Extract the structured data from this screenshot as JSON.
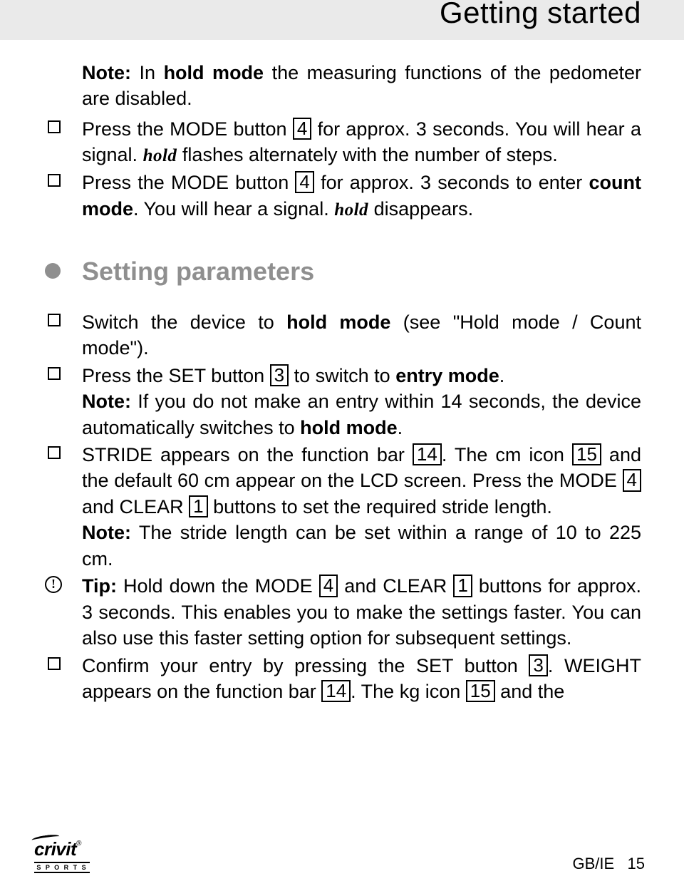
{
  "header": {
    "title": "Getting started"
  },
  "intro": {
    "note_label": "Note:",
    "note_a": " In ",
    "note_b": "hold mode",
    "note_c": " the measuring functions of the pedometer are disabled."
  },
  "top_items": [
    {
      "bullet": "square",
      "t1": "Press the MODE button ",
      "n1": "4",
      "t2": " for approx. 3 seconds. You will hear a signal. ",
      "hold": "hold",
      "t3": " flashes alternately with the number of steps."
    },
    {
      "bullet": "square",
      "t1": "Press the MODE button ",
      "n1": "4",
      "t2": " for approx. 3 seconds to enter ",
      "b1": "count mode",
      "t3": ". You will hear a signal. ",
      "hold": "hold",
      "t4": " disappears."
    }
  ],
  "section": {
    "heading": "Setting parameters"
  },
  "items": [
    {
      "bullet": "square",
      "t1": "Switch the device to ",
      "b1": "hold mode",
      "t2": " (see \"Hold mode / Count mode\")."
    },
    {
      "bullet": "square",
      "t1": "Press the SET button ",
      "n1": "3",
      "t2": " to switch to ",
      "b1": "entry mode",
      "t3": ".",
      "note_l": "Note:",
      "note_a": " If you do not make an entry within 14 seconds, the device automatically switches to ",
      "note_b": "hold mode",
      "note_c": "."
    },
    {
      "bullet": "square",
      "t1": "STRIDE appears on the function bar ",
      "n1": "14",
      "t2": ". The cm icon ",
      "n2": "15",
      "t3": " and the default 60 cm appear on the LCD screen. Press the MODE ",
      "n3": "4",
      "t4": " and CLEAR ",
      "n4": "1",
      "t5": " buttons to set the required stride length.",
      "note_l": "Note:",
      "note_a": " The stride length can be set within a range of 10 to 225 cm."
    },
    {
      "bullet": "info",
      "tip_l": "Tip:",
      "t1": " Hold down the MODE ",
      "n1": "4",
      "t2": " and CLEAR ",
      "n2": "1",
      "t3": " buttons for approx. 3 seconds. This enables you to make the settings faster. You can also use this faster setting option for subsequent settings."
    },
    {
      "bullet": "square",
      "t1": "Confirm your entry by pressing the SET button ",
      "n1": "3",
      "t2": ". WEIGHT appears on the function bar ",
      "n2": "14",
      "t3": ". The kg icon ",
      "n3": "15",
      "t4": " and the"
    }
  ],
  "footer": {
    "brand": "crivit",
    "reg": "®",
    "sports": "S P O R T S",
    "region": "GB/IE",
    "page": "15"
  }
}
